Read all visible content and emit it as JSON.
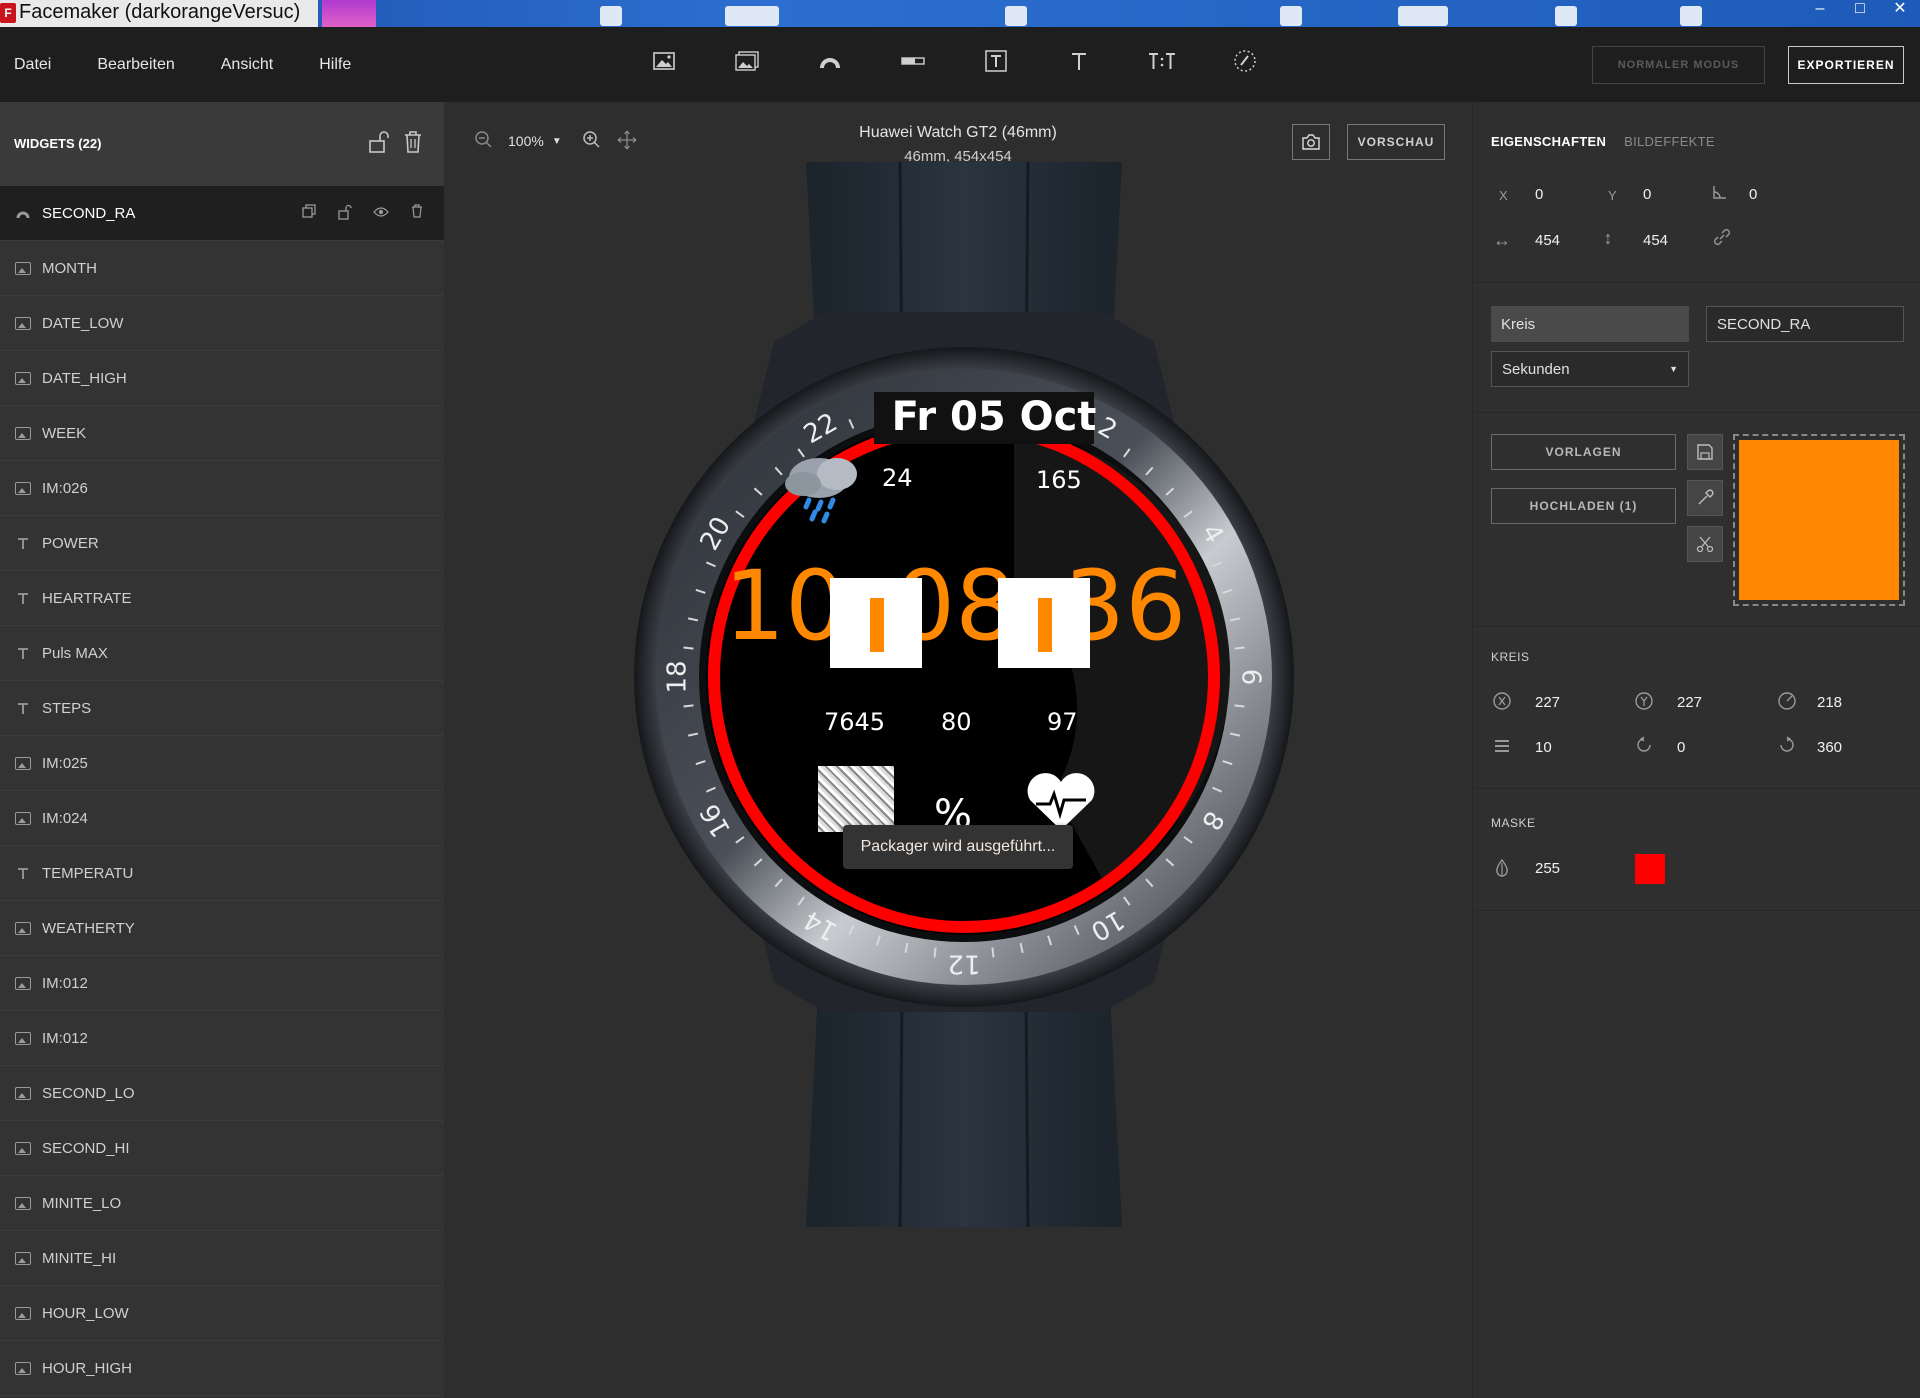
{
  "window": {
    "title": "Facemaker (darkorangeVersuc)",
    "app_badge": "F",
    "controls": [
      "–",
      "□",
      "✕"
    ]
  },
  "menu": {
    "items": [
      "Datei",
      "Bearbeiten",
      "Ansicht",
      "Hilfe"
    ],
    "toolbar_icons": [
      "image-icon",
      "image-stack-icon",
      "arc-icon",
      "progress-bar-icon",
      "text-box-icon",
      "text-icon",
      "text-time-icon",
      "hand-icon"
    ],
    "normal_mode_label": "NORMALER MODUS",
    "export_label": "EXPORTIEREN"
  },
  "left": {
    "widgets_label": "WIDGETS",
    "widgets_count": "(22)",
    "layers": [
      {
        "name": "SECOND_RA",
        "type": "arc",
        "selected": true
      },
      {
        "name": "MONTH",
        "type": "image"
      },
      {
        "name": "DATE_LOW",
        "type": "image"
      },
      {
        "name": "DATE_HIGH",
        "type": "image"
      },
      {
        "name": "WEEK",
        "type": "image"
      },
      {
        "name": "IM:026",
        "type": "image"
      },
      {
        "name": "POWER",
        "type": "text"
      },
      {
        "name": "HEARTRATE",
        "type": "text"
      },
      {
        "name": "Puls MAX",
        "type": "text"
      },
      {
        "name": "STEPS",
        "type": "text"
      },
      {
        "name": "IM:025",
        "type": "image"
      },
      {
        "name": "IM:024",
        "type": "image"
      },
      {
        "name": "TEMPERATU",
        "type": "text"
      },
      {
        "name": "WEATHERTY",
        "type": "image"
      },
      {
        "name": "IM:012",
        "type": "image"
      },
      {
        "name": "IM:012",
        "type": "image"
      },
      {
        "name": "SECOND_LO",
        "type": "image"
      },
      {
        "name": "SECOND_HI",
        "type": "image"
      },
      {
        "name": "MINITE_LO",
        "type": "image"
      },
      {
        "name": "MINITE_HI",
        "type": "image"
      },
      {
        "name": "HOUR_LOW",
        "type": "image"
      },
      {
        "name": "HOUR_HIGH",
        "type": "image"
      }
    ]
  },
  "canvas": {
    "zoom": "100%",
    "device_name": "Huawei Watch GT2 (46mm)",
    "device_size": "46mm, 454x454",
    "preview_label": "VORSCHAU",
    "toast": "Packager wird ausgeführt...",
    "watch_face": {
      "date": "Fr 05 Oct",
      "temperature": "24",
      "value_top_right": "165",
      "time_left": "10",
      "time_mid": "08",
      "time_right": "36",
      "steps": "7645",
      "value_center": "80",
      "value_right": "97",
      "percent": "%",
      "bezel_numbers": [
        "2",
        "4",
        "6",
        "8",
        "10",
        "12",
        "14",
        "16",
        "18",
        "20",
        "22"
      ]
    },
    "colors": {
      "arc_red": "#ff0000",
      "digits_orange": "#ff8800"
    }
  },
  "right": {
    "tabs": [
      "EIGENSCHAFTEN",
      "BILDEFFEKTE"
    ],
    "position": {
      "x_label": "X",
      "x": "0",
      "y_label": "Y",
      "y": "0",
      "angle": "0",
      "width": "454",
      "height": "454"
    },
    "shape_type": "Kreis",
    "widget_name": "SECOND_RA",
    "source": "Sekunden",
    "templates_label": "VORLAGEN",
    "upload_label": "HOCHLADEN (1)",
    "color": "#ff8800",
    "circle_section": "KREIS",
    "circle": {
      "cx": "227",
      "cy": "227",
      "radius": "218",
      "thickness": "10",
      "start": "0",
      "end": "360"
    },
    "mask_section": "MASKE",
    "mask_alpha": "255",
    "mask_color": "#ff0000"
  }
}
